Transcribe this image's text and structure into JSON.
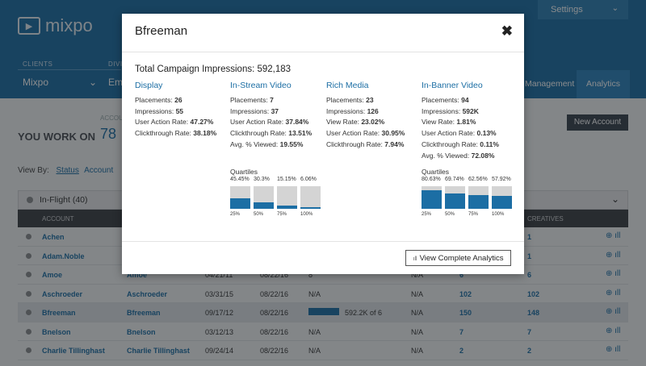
{
  "app": {
    "logo_text": "mixpo",
    "settings_label": "Settings",
    "clients_label": "CLIENTS",
    "clients_value": "Mixpo",
    "division_label": "DIVIS",
    "division_value": "Empl",
    "tabs": [
      {
        "label": "Management"
      },
      {
        "label": "Analytics"
      }
    ],
    "account_label": "ACCOUN",
    "you_work_on": "YOU WORK ON",
    "count": "78",
    "new_account_label": "New Account",
    "view_by_label": "View By:",
    "view_by_status": "Status",
    "view_by_account": "Account",
    "group_label": "In-Flight (40)",
    "columns": {
      "account": "ACCOUNT",
      "creatives": "CREATIVES"
    },
    "rows": [
      {
        "name": "Achen",
        "name2": "",
        "d1": "",
        "d2": "",
        "imp": "",
        "na2": "",
        "placements": "",
        "creatives": "1",
        "bar": false
      },
      {
        "name": "Adam.Noble",
        "name2": "",
        "d1": "",
        "d2": "",
        "imp": "",
        "na2": "",
        "placements": "",
        "creatives": "1",
        "bar": false
      },
      {
        "name": "Amoe",
        "name2": "Amoe",
        "d1": "04/21/11",
        "d2": "08/22/16",
        "imp": "8",
        "na2": "N/A",
        "placements": "6",
        "creatives": "6",
        "bar": false
      },
      {
        "name": "Aschroeder",
        "name2": "Aschroeder",
        "d1": "03/31/15",
        "d2": "08/22/16",
        "imp": "N/A",
        "na2": "N/A",
        "placements": "102",
        "creatives": "102",
        "bar": false
      },
      {
        "name": "Bfreeman",
        "name2": "Bfreeman",
        "d1": "09/17/12",
        "d2": "08/22/16",
        "imp": "592.2K of 6",
        "na2": "N/A",
        "placements": "150",
        "creatives": "148",
        "bar": true
      },
      {
        "name": "Bnelson",
        "name2": "Bnelson",
        "d1": "03/12/13",
        "d2": "08/22/16",
        "imp": "N/A",
        "na2": "N/A",
        "placements": "7",
        "creatives": "7",
        "bar": false
      },
      {
        "name": "Charlie Tillinghast",
        "name2": "Charlie Tillinghast",
        "d1": "09/24/14",
        "d2": "08/22/16",
        "imp": "N/A",
        "na2": "N/A",
        "placements": "2",
        "creatives": "2",
        "bar": false
      }
    ],
    "row_icon": "⊕ ıll"
  },
  "modal": {
    "title": "Bfreeman",
    "total_impressions": "Total Campaign Impressions: 592,183",
    "columns": [
      {
        "title": "Display",
        "stats": [
          {
            "label": "Placements:",
            "value": "26"
          },
          {
            "label": "Impressions:",
            "value": "55"
          },
          {
            "label": "User Action Rate:",
            "value": "47.27%"
          },
          {
            "label": "Clickthrough Rate:",
            "value": "38.18%"
          }
        ]
      },
      {
        "title": "In-Stream Video",
        "stats": [
          {
            "label": "Placements:",
            "value": "7"
          },
          {
            "label": "Impressions:",
            "value": "37"
          },
          {
            "label": "User Action Rate:",
            "value": "37.84%"
          },
          {
            "label": "Clickthrough Rate:",
            "value": "13.51%"
          },
          {
            "label": "Avg. % Viewed:",
            "value": "19.55%"
          }
        ]
      },
      {
        "title": "Rich Media",
        "stats": [
          {
            "label": "Placements:",
            "value": "23"
          },
          {
            "label": "Impressions:",
            "value": "126"
          },
          {
            "label": "View Rate:",
            "value": "23.02%"
          },
          {
            "label": "User Action Rate:",
            "value": "30.95%"
          },
          {
            "label": "Clickthrough Rate:",
            "value": "7.94%"
          }
        ]
      },
      {
        "title": "In-Banner Video",
        "stats": [
          {
            "label": "Placements:",
            "value": "94"
          },
          {
            "label": "Impressions:",
            "value": "592K"
          },
          {
            "label": "View Rate:",
            "value": "1.81%"
          },
          {
            "label": "User Action Rate:",
            "value": "0.13%"
          },
          {
            "label": "Clickthrough Rate:",
            "value": "0.11%"
          },
          {
            "label": "Avg. % Viewed:",
            "value": "72.08%"
          }
        ]
      }
    ],
    "quartiles_label": "Quartiles",
    "quartiles": [
      {
        "pcts": [
          "45.45%",
          "30.3%",
          "15.15%",
          "6.06%"
        ],
        "values": [
          45.45,
          30.3,
          15.15,
          6.06
        ]
      },
      {
        "pcts": [
          "80.63%",
          "69.74%",
          "62.56%",
          "57.92%"
        ],
        "values": [
          80.63,
          69.74,
          62.56,
          57.92
        ]
      }
    ],
    "quartile_keys": [
      "25%",
      "50%",
      "75%",
      "100%"
    ],
    "button_label": "View Complete Analytics",
    "close_icon": "close-icon"
  },
  "colors": {
    "brand_blue": "#1c6ea4",
    "bar_gray": "#d4d4d4"
  }
}
